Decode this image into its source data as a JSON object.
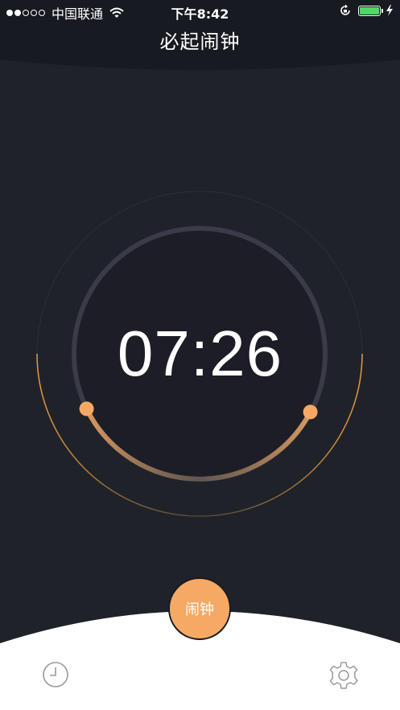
{
  "status_bar": {
    "signal_strength": "2/5",
    "carrier": "中国联通",
    "time": "下午8:42",
    "battery_level": 1.0,
    "icons": [
      "signal-dots-icon",
      "wifi-icon",
      "rotation-lock-icon",
      "battery-icon",
      "charging-bolt-icon"
    ]
  },
  "header": {
    "title": "必起闹钟"
  },
  "dial": {
    "time": "07:26"
  },
  "bottom_nav": {
    "alarm_label": "闹钟",
    "left_icon": "clock-icon",
    "right_icon": "gear-icon"
  },
  "colors": {
    "background": "#1f2229",
    "header": "#181a22",
    "dial_face": "#1c1d26",
    "accent": "#f6a964",
    "battery": "#4cd964",
    "bottom_panel": "#ffffff"
  }
}
